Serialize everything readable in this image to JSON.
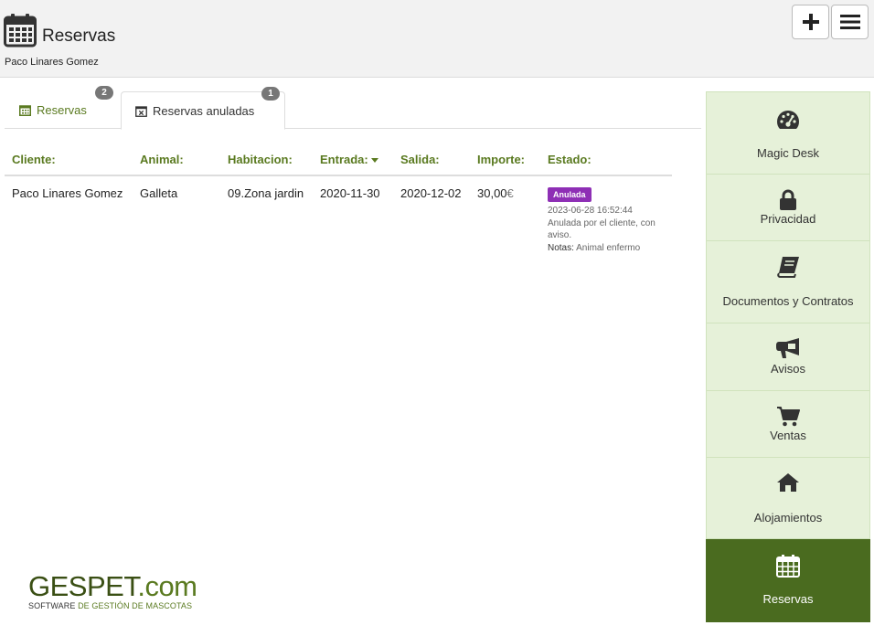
{
  "header": {
    "title": "Reservas",
    "subtitle": "Paco Linares Gomez",
    "icon": "calendar-icon",
    "add_icon": "plus-icon",
    "menu_icon": "hamburger-icon"
  },
  "tabs": [
    {
      "label": "Reservas",
      "badge": "2",
      "icon": "calendar-icon",
      "active": false
    },
    {
      "label": "Reservas anuladas",
      "badge": "1",
      "icon": "calendar-x-icon",
      "active": true
    }
  ],
  "table": {
    "headers": [
      "Cliente:",
      "Animal:",
      "Habitacion:",
      "Entrada:",
      "Salida:",
      "Importe:",
      "Estado:"
    ],
    "rows": [
      {
        "cliente": "Paco Linares Gomez",
        "animal": "Galleta",
        "habitacion": "09.Zona jardin",
        "entrada": "2020-11-30",
        "salida": "2020-12-02",
        "importe": "30,00",
        "currency": "€",
        "estado": "Anulada",
        "fecha_anulacion": "2023-06-28 16:52:44",
        "motivo": "Anulada por el cliente, con aviso.",
        "notas_label": "Notas:",
        "notas": "Animal enfermo"
      }
    ]
  },
  "logo": {
    "brand": "GESPET",
    "domain": ".com",
    "tag_1": "SOFTWARE ",
    "tag_2": "DE GESTIÓN DE MASCOTAS"
  },
  "sidebar": [
    {
      "label": "Magic Desk",
      "icon": "dashboard-icon",
      "active": false
    },
    {
      "label": "Privacidad",
      "icon": "lock-icon",
      "active": false
    },
    {
      "label": "Documentos y Contratos",
      "icon": "book-icon",
      "active": false
    },
    {
      "label": "Avisos",
      "icon": "megaphone-icon",
      "active": false
    },
    {
      "label": "Ventas",
      "icon": "cart-icon",
      "active": false
    },
    {
      "label": "Alojamientos",
      "icon": "home-icon",
      "active": false
    },
    {
      "label": "Reservas",
      "icon": "calendar-icon",
      "active": true
    }
  ],
  "colors": {
    "accent": "#5a7a20",
    "sidebar_bg": "#e6f1d9",
    "sidebar_active": "#4a6b1f",
    "status_anulada": "#8e2fb5"
  }
}
